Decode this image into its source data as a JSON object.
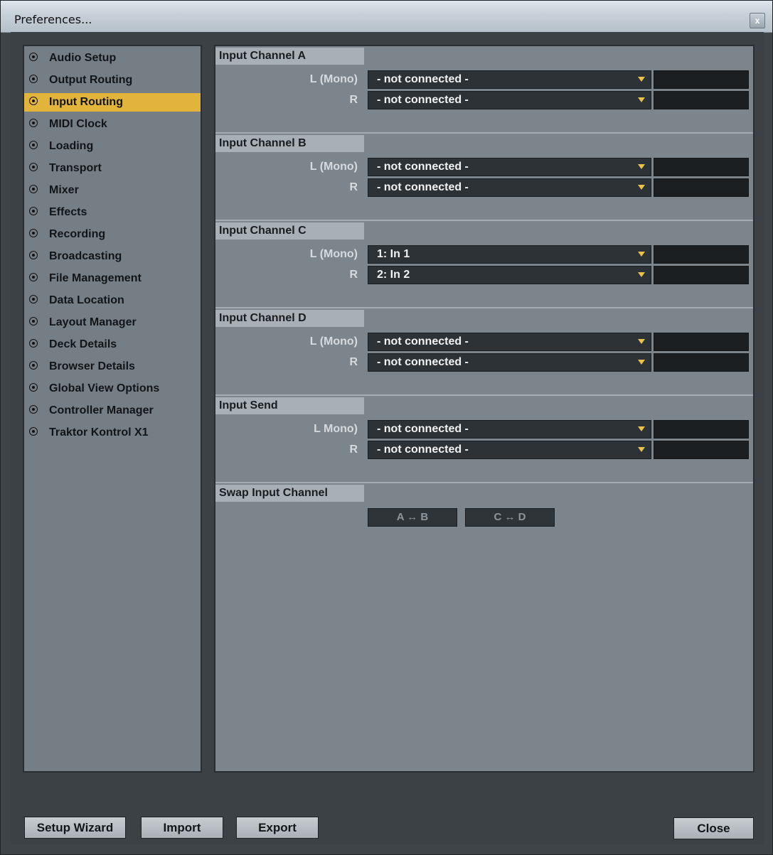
{
  "window": {
    "title": "Preferences...",
    "close_glyph": "x"
  },
  "sidebar": {
    "items": [
      {
        "label": "Audio Setup",
        "active": false
      },
      {
        "label": "Output Routing",
        "active": false
      },
      {
        "label": "Input Routing",
        "active": true
      },
      {
        "label": "MIDI Clock",
        "active": false
      },
      {
        "label": "Loading",
        "active": false
      },
      {
        "label": "Transport",
        "active": false
      },
      {
        "label": "Mixer",
        "active": false
      },
      {
        "label": "Effects",
        "active": false
      },
      {
        "label": "Recording",
        "active": false
      },
      {
        "label": "Broadcasting",
        "active": false
      },
      {
        "label": "File Management",
        "active": false
      },
      {
        "label": "Data Location",
        "active": false
      },
      {
        "label": "Layout Manager",
        "active": false
      },
      {
        "label": "Deck Details",
        "active": false
      },
      {
        "label": "Browser Details",
        "active": false
      },
      {
        "label": "Global View Options",
        "active": false
      },
      {
        "label": "Controller Manager",
        "active": false
      },
      {
        "label": "Traktor Kontrol X1",
        "active": false
      }
    ]
  },
  "sections": [
    {
      "title": "Input Channel A",
      "rows": [
        {
          "label": "L (Mono)",
          "value": "- not connected -"
        },
        {
          "label": "R",
          "value": "- not connected -"
        }
      ]
    },
    {
      "title": "Input Channel B",
      "rows": [
        {
          "label": "L (Mono)",
          "value": "- not connected -"
        },
        {
          "label": "R",
          "value": "- not connected -"
        }
      ]
    },
    {
      "title": "Input Channel C",
      "rows": [
        {
          "label": "L (Mono)",
          "value": "1: In 1"
        },
        {
          "label": "R",
          "value": "2: In 2"
        }
      ]
    },
    {
      "title": "Input Channel D",
      "rows": [
        {
          "label": "L (Mono)",
          "value": "- not connected -"
        },
        {
          "label": "R",
          "value": "- not connected -"
        }
      ]
    },
    {
      "title": "Input Send",
      "rows": [
        {
          "label": "L Mono)",
          "value": "- not connected -"
        },
        {
          "label": "R",
          "value": "- not connected -"
        }
      ]
    }
  ],
  "swap": {
    "title": "Swap Input Channel",
    "buttons": [
      "A ↔ B",
      "C ↔ D"
    ]
  },
  "footer": {
    "setup_wizard": "Setup Wizard",
    "import": "Import",
    "export": "Export",
    "close": "Close"
  },
  "colors": {
    "accent": "#e3b43c",
    "dropdown_arrow": "#e8c24a"
  },
  "icons": {
    "sidebar_bullet": "radio-bullet-icon",
    "dropdown_arrow": "dropdown-arrow-icon"
  }
}
